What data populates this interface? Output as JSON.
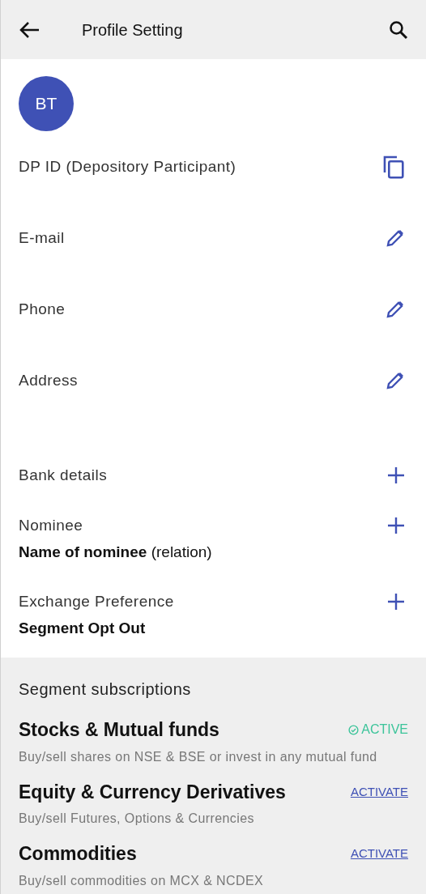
{
  "header": {
    "title": "Profile Setting"
  },
  "avatar": {
    "initials": "BT"
  },
  "fields": [
    {
      "label": "DP ID (Depository Participant)",
      "kind": "copy"
    },
    {
      "label": "E-mail",
      "kind": "edit"
    },
    {
      "label": "Phone",
      "kind": "edit"
    },
    {
      "label": "Address",
      "kind": "edit"
    },
    {
      "label": "Bank details",
      "kind": "add"
    },
    {
      "label": "Nominee",
      "kind": "add",
      "detail": "**Name of nominee** (relation)"
    },
    {
      "label": "Exchange Preference",
      "kind": "add",
      "detail": "**Segment Opt Out**"
    }
  ],
  "segments": {
    "title": "Segment subscriptions",
    "items": [
      {
        "name": "Stocks & Mutual funds",
        "description": "Buy/sell shares on NSE & BSE or invest in any mutual fund",
        "kind": "active",
        "status_label": "ACTIVE"
      },
      {
        "name": "Equity & Currency Derivatives",
        "description": "Buy/sell Futures, Options & Currencies",
        "kind": "inactive",
        "status_label": "ACTIVATE"
      },
      {
        "name": "Commodities",
        "description": "Buy/sell commodities on MCX & NCDEX",
        "kind": "inactive",
        "status_label": "ACTIVATE"
      }
    ]
  }
}
